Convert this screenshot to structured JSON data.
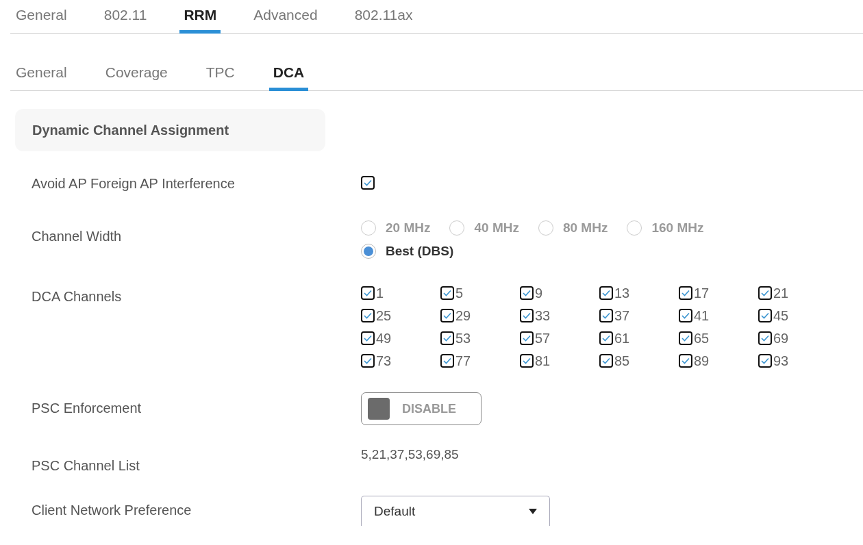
{
  "top_tabs": [
    {
      "label": "General",
      "selected": false
    },
    {
      "label": "802.11",
      "selected": false
    },
    {
      "label": "RRM",
      "selected": true
    },
    {
      "label": "Advanced",
      "selected": false
    },
    {
      "label": "802.11ax",
      "selected": false
    }
  ],
  "sub_tabs": [
    {
      "label": "General",
      "selected": false
    },
    {
      "label": "Coverage",
      "selected": false
    },
    {
      "label": "TPC",
      "selected": false
    },
    {
      "label": "DCA",
      "selected": true
    }
  ],
  "section_title": "Dynamic Channel Assignment",
  "settings": [
    {
      "kind": "checkbox",
      "label": "Avoid AP Foreign AP Interference",
      "checked": true
    },
    {
      "kind": "radio_group",
      "label": "Channel Width",
      "options": [
        {
          "label": "20 MHz",
          "selected": false,
          "disabled": true
        },
        {
          "label": "40 MHz",
          "selected": false,
          "disabled": true
        },
        {
          "label": "80 MHz",
          "selected": false,
          "disabled": true
        },
        {
          "label": "160 MHz",
          "selected": false,
          "disabled": true
        },
        {
          "label": "Best (DBS)",
          "selected": true,
          "disabled": false
        }
      ]
    },
    {
      "kind": "checkbox_grid",
      "label": "DCA Channels",
      "options": [
        {
          "label": "1",
          "checked": true
        },
        {
          "label": "5",
          "checked": true
        },
        {
          "label": "9",
          "checked": true
        },
        {
          "label": "13",
          "checked": true
        },
        {
          "label": "17",
          "checked": true
        },
        {
          "label": "21",
          "checked": true
        },
        {
          "label": "25",
          "checked": true
        },
        {
          "label": "29",
          "checked": true
        },
        {
          "label": "33",
          "checked": true
        },
        {
          "label": "37",
          "checked": true
        },
        {
          "label": "41",
          "checked": true
        },
        {
          "label": "45",
          "checked": true
        },
        {
          "label": "49",
          "checked": true
        },
        {
          "label": "53",
          "checked": true
        },
        {
          "label": "57",
          "checked": true
        },
        {
          "label": "61",
          "checked": true
        },
        {
          "label": "65",
          "checked": true
        },
        {
          "label": "69",
          "checked": true
        },
        {
          "label": "73",
          "checked": true
        },
        {
          "label": "77",
          "checked": true
        },
        {
          "label": "81",
          "checked": true
        },
        {
          "label": "85",
          "checked": true
        },
        {
          "label": "89",
          "checked": true
        },
        {
          "label": "93",
          "checked": true
        }
      ]
    },
    {
      "kind": "toggle",
      "label": "PSC Enforcement",
      "on": false,
      "state_label": "DISABLE"
    },
    {
      "kind": "text",
      "label": "PSC Channel List",
      "value": "5,21,37,53,69,85"
    },
    {
      "kind": "select",
      "label": "Client Network Preference",
      "value": "Default"
    }
  ]
}
